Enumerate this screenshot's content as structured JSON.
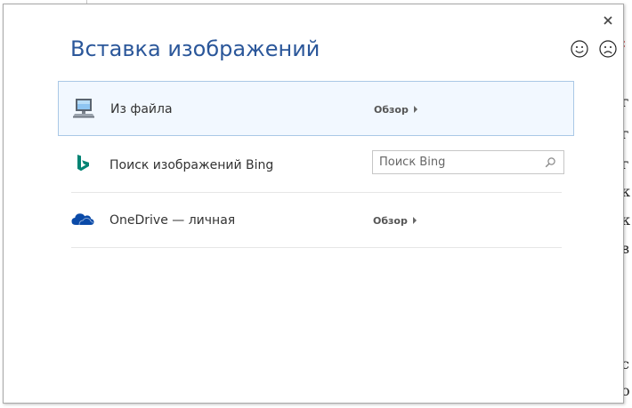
{
  "dialog": {
    "title": "Вставка изображений",
    "close_label": "×"
  },
  "sources": [
    {
      "label": "Из файла",
      "action": "Обзор",
      "icon": "computer-monitor-icon",
      "selected": true
    },
    {
      "label": "Поиск изображений Bing",
      "search_placeholder": "Поиск Bing",
      "icon": "bing-logo-icon"
    },
    {
      "label": "OneDrive — личная",
      "action": "Обзор",
      "icon": "onedrive-cloud-icon"
    }
  ],
  "colors": {
    "title": "#2b579a",
    "selected_row_bg": "#f2f8ff",
    "selected_row_border": "#aac8e6",
    "bing_teal": "#008373",
    "onedrive_blue": "#0a4aa8"
  }
}
